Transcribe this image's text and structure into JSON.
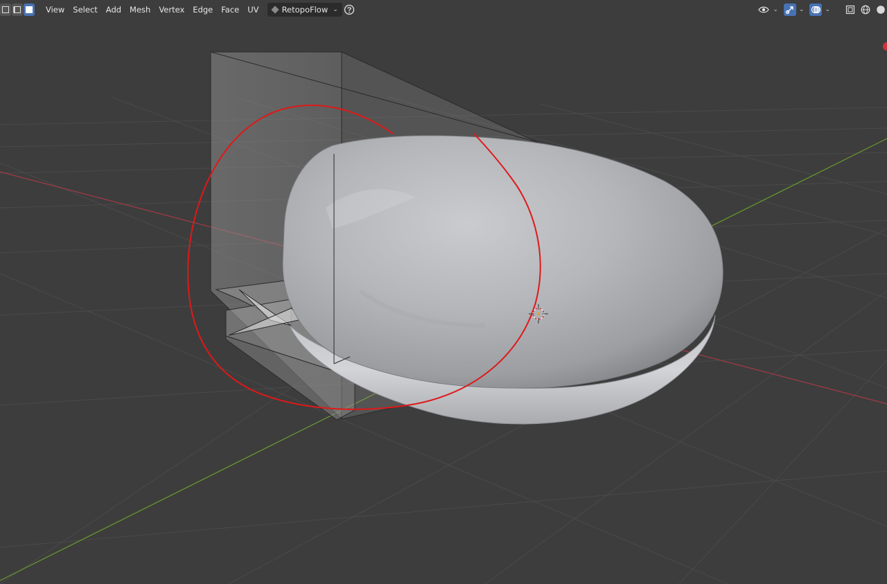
{
  "header": {
    "select_modes": [
      {
        "name": "vertex-select",
        "active": false
      },
      {
        "name": "edge-select",
        "active": false
      },
      {
        "name": "face-select",
        "active": true
      }
    ],
    "menu": [
      {
        "id": "view",
        "label": "View"
      },
      {
        "id": "select",
        "label": "Select"
      },
      {
        "id": "add",
        "label": "Add"
      },
      {
        "id": "mesh",
        "label": "Mesh"
      },
      {
        "id": "vertex",
        "label": "Vertex"
      },
      {
        "id": "edge",
        "label": "Edge"
      },
      {
        "id": "face",
        "label": "Face"
      },
      {
        "id": "uv",
        "label": "UV"
      }
    ],
    "addon_label": "RetopoFlow"
  },
  "icons": {
    "help": "help-icon",
    "visibility": "eye-icon",
    "gizmo": "gizmo-icon",
    "overlays": "overlays-icon",
    "xray": "xray-icon",
    "shading_wire": "wireframe-shading-icon"
  },
  "colors": {
    "background": "#3d3d3d",
    "grid": "#4a4a4a",
    "x_axis": "#a53a46",
    "y_axis": "#6e9a2e",
    "active_mode": "#4772b3",
    "brush_circle": "#e01818",
    "mesh": "#b8babd"
  }
}
